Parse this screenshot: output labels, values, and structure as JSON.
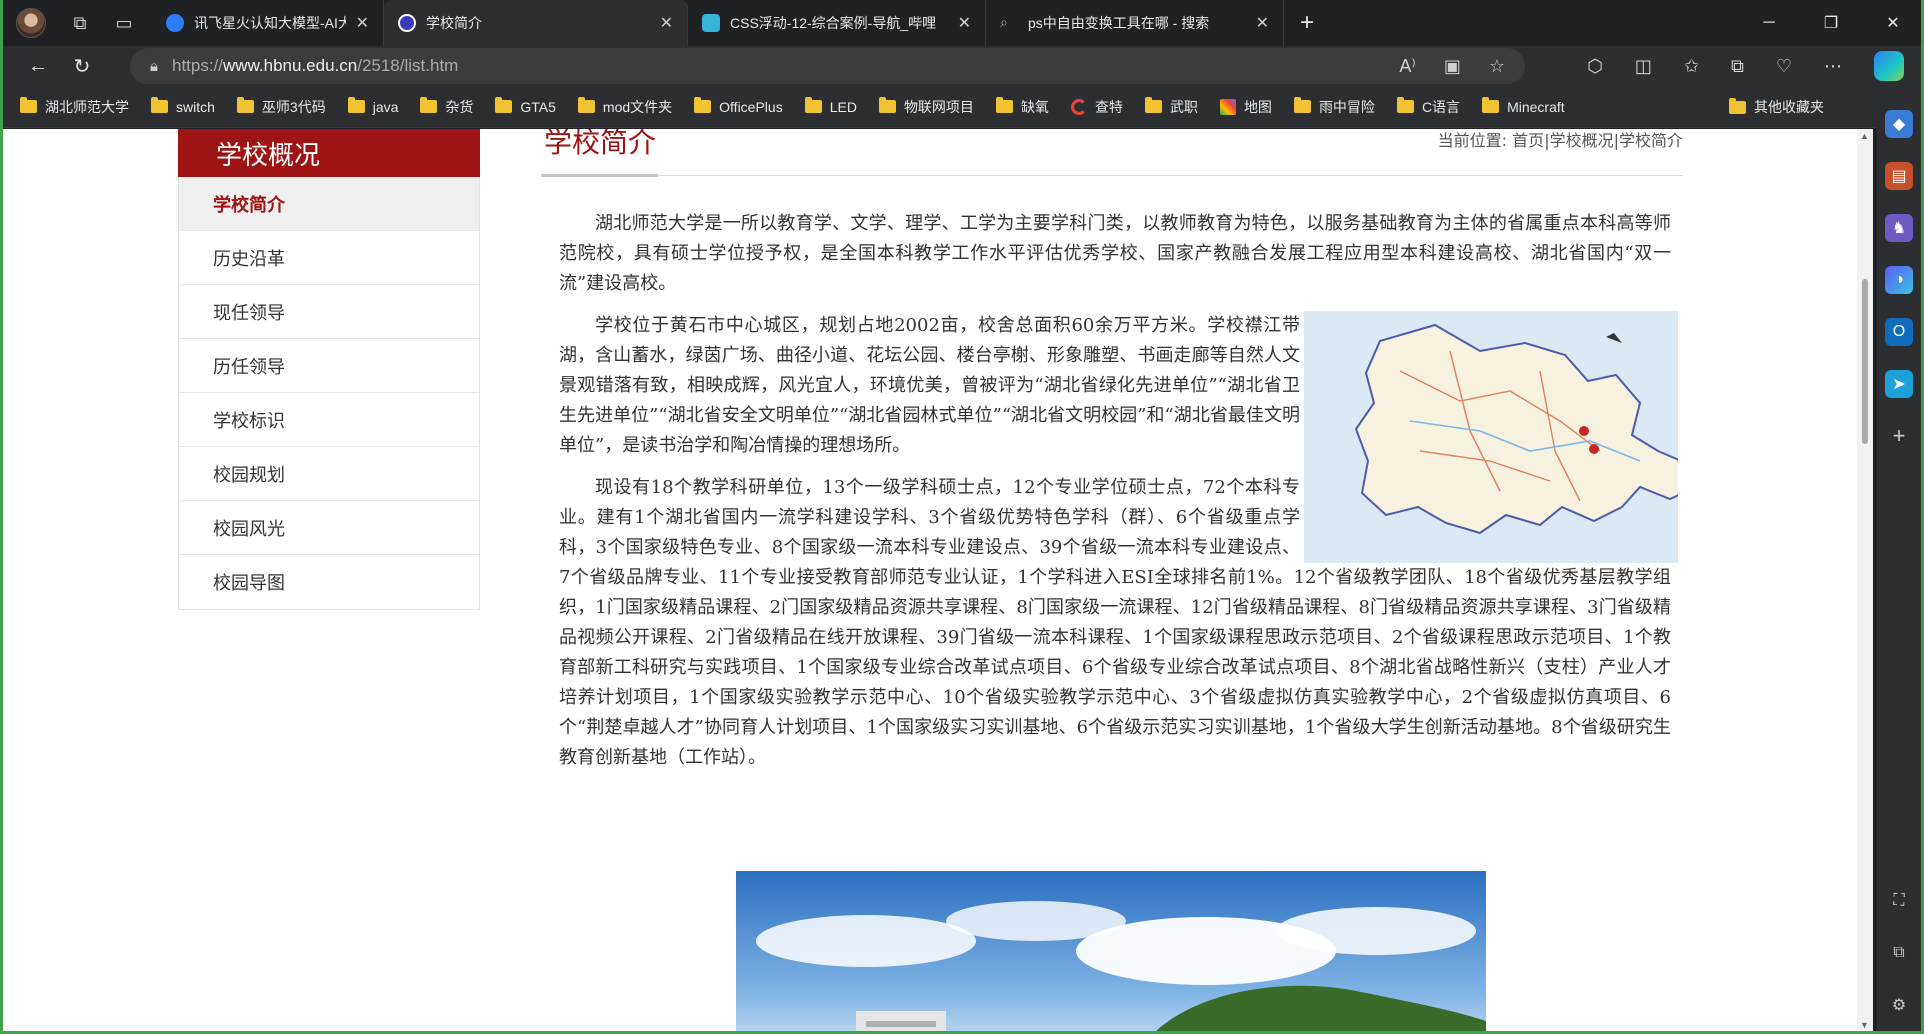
{
  "browser": {
    "tabs": [
      {
        "title": "讯飞星火认知大模型-AI大语言模",
        "favicon_color": "#2f7df6",
        "active": false
      },
      {
        "title": "学校简介",
        "favicon_color": "#3b3bb8",
        "active": true
      },
      {
        "title": "CSS浮动-12-综合案例-导航_哔哩",
        "favicon_color": "#36b5d9",
        "active": false
      },
      {
        "title": "ps中自由变换工具在哪 - 搜索",
        "favicon_color": "#5a5a5a",
        "active": false
      }
    ],
    "url": {
      "scheme": "https://",
      "host": "www.hbnu.edu.cn",
      "path": "/2518/list.htm"
    },
    "bookmarks": [
      {
        "label": "湖北师范大学",
        "icon": "folder-icon"
      },
      {
        "label": "switch",
        "icon": "folder-icon"
      },
      {
        "label": "巫师3代码",
        "icon": "folder-icon"
      },
      {
        "label": "java",
        "icon": "folder-icon"
      },
      {
        "label": "杂货",
        "icon": "folder-icon"
      },
      {
        "label": "GTA5",
        "icon": "folder-icon"
      },
      {
        "label": "mod文件夹",
        "icon": "folder-icon"
      },
      {
        "label": "OfficePlus",
        "icon": "folder-icon"
      },
      {
        "label": "LED",
        "icon": "folder-icon"
      },
      {
        "label": "物联网项目",
        "icon": "folder-icon"
      },
      {
        "label": "缺氧",
        "icon": "folder-icon"
      },
      {
        "label": "查特",
        "icon": "g-icon"
      },
      {
        "label": "武职",
        "icon": "folder-icon"
      },
      {
        "label": "地图",
        "icon": "map-icon"
      },
      {
        "label": "雨中冒险",
        "icon": "folder-icon"
      },
      {
        "label": "C语言",
        "icon": "folder-icon"
      },
      {
        "label": "Minecraft",
        "icon": "folder-icon"
      }
    ],
    "other_bookmarks": "其他收藏夹"
  },
  "site": {
    "section_title": "学校概况",
    "menu": [
      {
        "label": "学校简介",
        "active": true
      },
      {
        "label": "历史沿革",
        "active": false
      },
      {
        "label": "现任领导",
        "active": false
      },
      {
        "label": "历任领导",
        "active": false
      },
      {
        "label": "学校标识",
        "active": false
      },
      {
        "label": "校园规划",
        "active": false
      },
      {
        "label": "校园风光",
        "active": false
      },
      {
        "label": "校园导图",
        "active": false
      }
    ],
    "page_title": "学校简介",
    "breadcrumb": {
      "prefix": "当前位置:",
      "items": [
        "首页",
        "学校概况",
        "学校简介"
      ],
      "sep": "|"
    },
    "paragraphs": [
      "湖北师范大学是一所以教育学、文学、理学、工学为主要学科门类，以教师教育为特色，以服务基础教育为主体的省属重点本科高等师范院校，具有硕士学位授予权，是全国本科教学工作水平评估优秀学校、国家产教融合发展工程应用型本科建设高校、湖北省国内“双一流”建设高校。",
      "学校位于黄石市中心城区，规划占地2002亩，校舍总面积60余万平方米。学校襟江带湖，含山蓄水，绿茵广场、曲径小道、花坛公园、楼台亭榭、形象雕塑、书画走廊等自然人文景观错落有致，相映成辉，风光宜人，环境优美，曾被评为“湖北省绿化先进单位”“湖北省卫生先进单位”“湖北省安全文明单位”“湖北省园林式单位”“湖北省文明校园”和“湖北省最佳文明单位”，是读书治学和陶冶情操的理想场所。",
      "现设有18个教学科研单位，13个一级学科硕士点，12个专业学位硕士点，72个本科专业。建有1个湖北省国内一流学科建设学科、3个省级优势特色学科（群）、6个省级重点学科，3个国家级特色专业、8个国家级一流本科专业建设点、39个省级一流本科专业建设点、7个省级品牌专业、11个专业接受教育部师范专业认证，1个学科进入ESI全球排名前1%。12个省级教学团队、18个省级优秀基层教学组织，1门国家级精品课程、2门国家级精品资源共享课程、8门国家级一流课程、12门省级精品课程、8门省级精品资源共享课程、3门省级精品视频公开课程、2门省级精品在线开放课程、39门省级一流本科课程、1个国家级课程思政示范项目、2个省级课程思政示范项目、1个教育部新工科研究与实践项目、1个国家级专业综合改革试点项目、6个省级专业综合改革试点项目、8个湖北省战略性新兴（支柱）产业人才培养计划项目，1个国家级实验教学示范中心、10个省级实验教学示范中心、3个省级虚拟仿真实验教学中心，2个省级虚拟仿真项目、6个“荆楚卓越人才”协同育人计划项目、1个国家级实习实训基地、6个省级示范实习实训基地，1个省级大学生创新活动基地。8个省级研究生教育创新基地（工作站）。"
    ]
  }
}
